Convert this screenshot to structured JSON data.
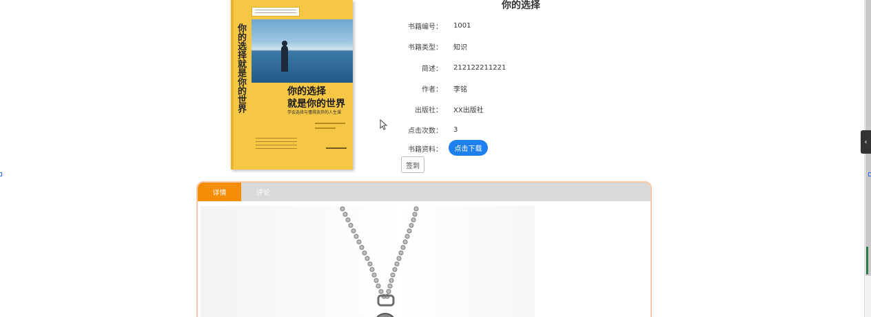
{
  "book": {
    "title": "你的选择",
    "cover": {
      "title_line1": "你的选择",
      "title_line2": "就是你的世界",
      "subtitle": "学会选择与懂得放弃的人生课",
      "spine_title": "你的选择就是你的世界"
    },
    "fields": [
      {
        "label": "书籍编号：",
        "value": "1001"
      },
      {
        "label": "书籍类型：",
        "value": "知识"
      },
      {
        "label": "简述：",
        "value": "212122211221"
      },
      {
        "label": "作者：",
        "value": "李铭"
      },
      {
        "label": "出版社：",
        "value": "XX出版社"
      },
      {
        "label": "点击次数：",
        "value": "3"
      },
      {
        "label": "书籍资料：",
        "value": ""
      }
    ],
    "download_label": "点击下载",
    "signin_label": "签到"
  },
  "tabs": [
    {
      "label": "详情",
      "active": true
    },
    {
      "label": "评论",
      "active": false
    }
  ],
  "colors": {
    "accent_tab": "#f48c06",
    "download_button": "#1e7fef",
    "tab_border": "#f9c7a7",
    "cover": "#f6c744"
  },
  "icons": {
    "cursor": "mouse-pointer-icon",
    "side_toggle": "chevron-left-icon"
  }
}
